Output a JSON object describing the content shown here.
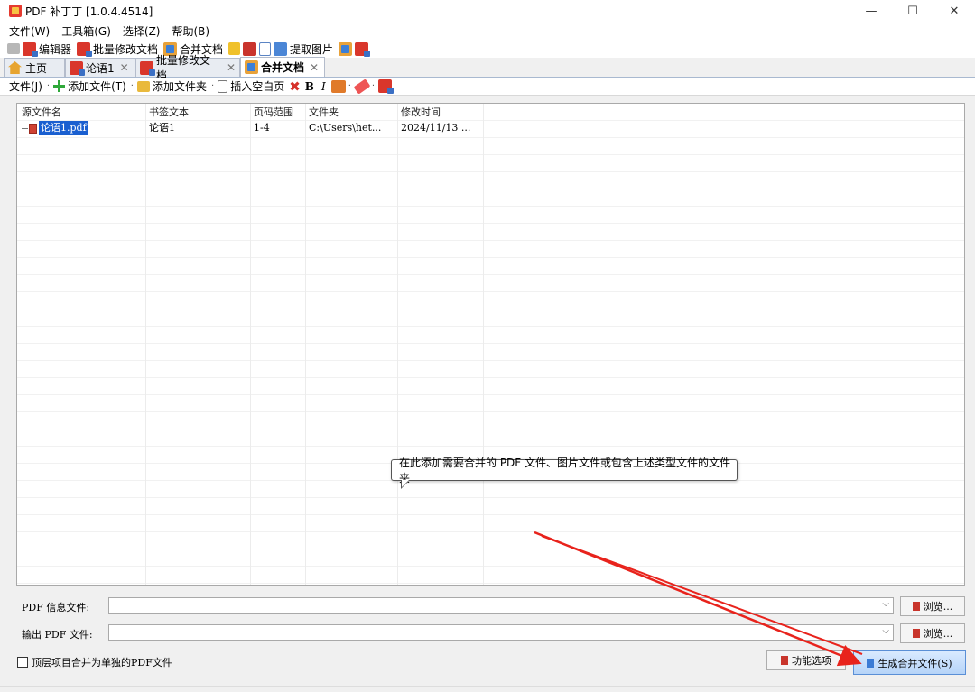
{
  "window": {
    "title": "PDF 补丁丁 [1.0.4.4514]",
    "controls": [
      "—",
      "☐",
      "✕"
    ]
  },
  "menu": [
    "文件(W)",
    "工具箱(G)",
    "选择(Z)",
    "帮助(B)"
  ],
  "quickbar": {
    "editor": "编辑器",
    "batch_edit": "批量修改文档",
    "merge": "合并文档",
    "extract_images": "提取图片"
  },
  "tabs": [
    {
      "label": "主页",
      "active": false,
      "closable": false
    },
    {
      "label": "论语1",
      "active": false,
      "closable": true
    },
    {
      "label": "批量修改文档",
      "active": false,
      "closable": true
    },
    {
      "label": "合并文档",
      "active": true,
      "closable": true
    }
  ],
  "toolbar": {
    "file": "文件(J)",
    "add_file": "添加文件(T)",
    "add_folder": "添加文件夹",
    "insert_blank": "插入空白页",
    "bold": "B",
    "italic": "I"
  },
  "grid": {
    "columns": [
      "源文件名",
      "书签文本",
      "页码范围",
      "文件夹",
      "修改时间"
    ],
    "rows": [
      {
        "file": "论语1.pdf",
        "bookmark": "论语1",
        "pages": "1-4",
        "folder": "C:\\Users\\het...",
        "modified": "2024/11/13 ..."
      }
    ]
  },
  "tooltip": "在此添加需要合并的 PDF 文件、图片文件或包含上述类型文件的文件夹",
  "form": {
    "info_label": "PDF 信息文件:",
    "output_label": "输出 PDF 文件:",
    "browse": "浏览...",
    "checkbox_label": "顶层项目合并为单独的PDF文件",
    "func_options": "功能选项",
    "generate": "生成合并文件(S)"
  },
  "colors": {
    "selection": "#1a5fd0",
    "annotation_arrow": "#e8231c"
  }
}
